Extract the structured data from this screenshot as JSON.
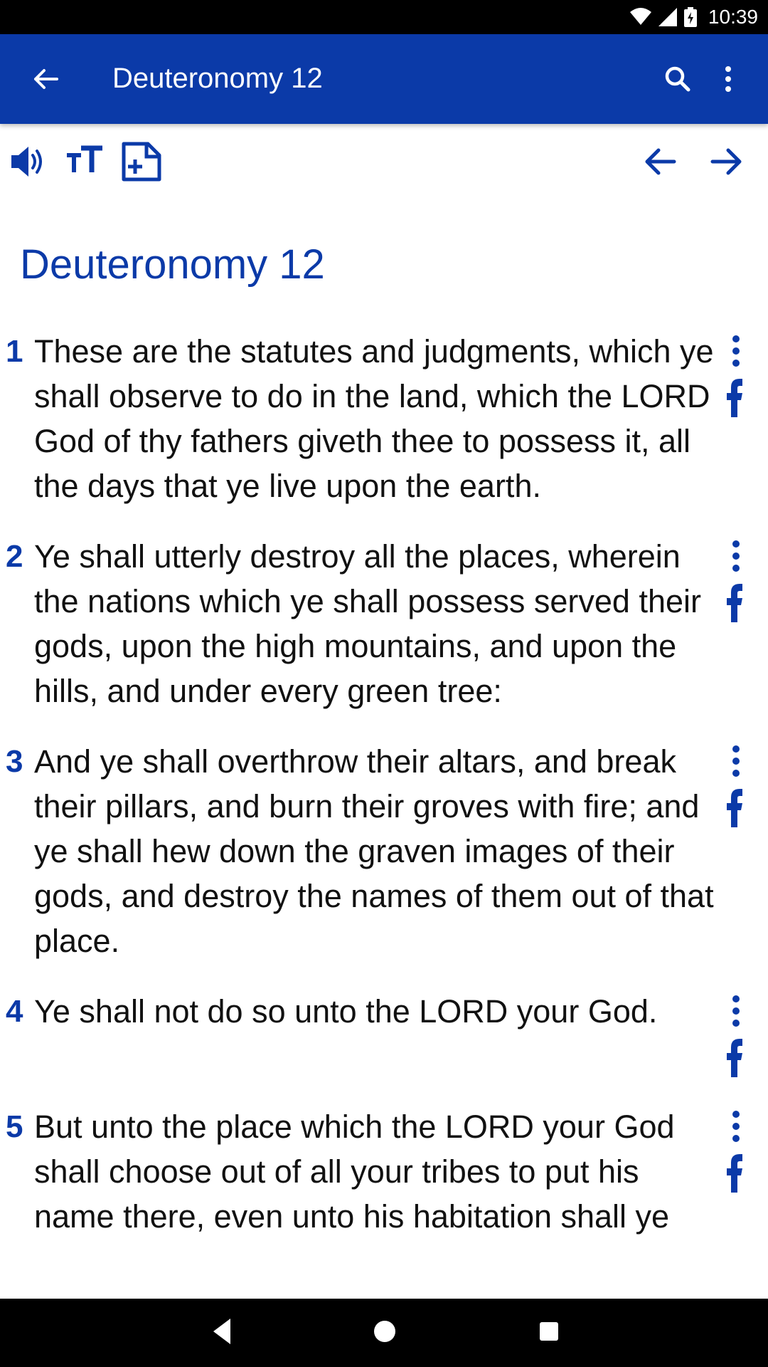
{
  "status_bar": {
    "time": "10:39"
  },
  "app_bar": {
    "title": "Deuteronomy 12"
  },
  "chapter_heading": "Deuteronomy 12",
  "verses": [
    {
      "num": "1",
      "text": "These are the statutes and judgments, which ye shall observe to do in the land, which the LORD God of thy fathers giveth thee to possess it, all the days that ye live upon the earth."
    },
    {
      "num": "2",
      "text": "Ye shall utterly destroy all the places, wherein the nations which ye shall possess served their gods, upon the high mountains, and upon the hills, and under every green tree:"
    },
    {
      "num": "3",
      "text": "And ye shall overthrow their altars, and break their pillars, and burn their groves with fire; and ye shall hew down the graven images of their gods, and destroy the names of them out of that place."
    },
    {
      "num": "4",
      "text": "Ye shall not do so unto the LORD your God."
    },
    {
      "num": "5",
      "text": "But unto the place which the LORD your God shall choose out of all your tribes to put his name there, even unto his habitation shall ye"
    }
  ],
  "icons": {
    "back": "arrow-left-icon",
    "search": "search-icon",
    "more": "more-vert-icon",
    "audio": "speaker-icon",
    "text_size": "text-size-icon",
    "add_note": "add-note-icon",
    "prev": "previous-chapter-icon",
    "next": "next-chapter-icon",
    "verse_menu": "more-vert-icon",
    "share": "facebook-icon"
  },
  "colors": {
    "primary": "#0b3aa8",
    "text": "#111111",
    "background": "#ffffff"
  }
}
